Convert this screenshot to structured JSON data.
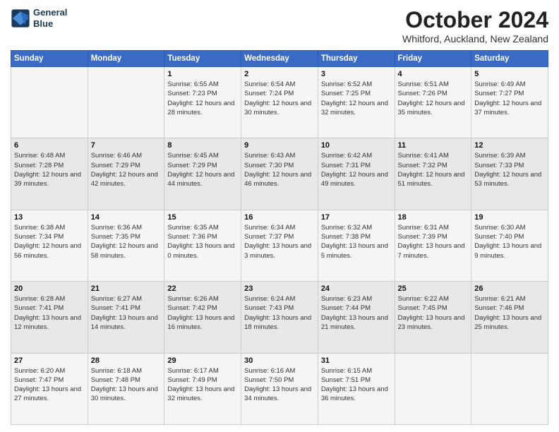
{
  "logo": {
    "line1": "General",
    "line2": "Blue"
  },
  "title": "October 2024",
  "location": "Whitford, Auckland, New Zealand",
  "days_of_week": [
    "Sunday",
    "Monday",
    "Tuesday",
    "Wednesday",
    "Thursday",
    "Friday",
    "Saturday"
  ],
  "weeks": [
    [
      {
        "day": "",
        "detail": ""
      },
      {
        "day": "",
        "detail": ""
      },
      {
        "day": "1",
        "detail": "Sunrise: 6:55 AM\nSunset: 7:23 PM\nDaylight: 12 hours\nand 28 minutes."
      },
      {
        "day": "2",
        "detail": "Sunrise: 6:54 AM\nSunset: 7:24 PM\nDaylight: 12 hours\nand 30 minutes."
      },
      {
        "day": "3",
        "detail": "Sunrise: 6:52 AM\nSunset: 7:25 PM\nDaylight: 12 hours\nand 32 minutes."
      },
      {
        "day": "4",
        "detail": "Sunrise: 6:51 AM\nSunset: 7:26 PM\nDaylight: 12 hours\nand 35 minutes."
      },
      {
        "day": "5",
        "detail": "Sunrise: 6:49 AM\nSunset: 7:27 PM\nDaylight: 12 hours\nand 37 minutes."
      }
    ],
    [
      {
        "day": "6",
        "detail": "Sunrise: 6:48 AM\nSunset: 7:28 PM\nDaylight: 12 hours\nand 39 minutes."
      },
      {
        "day": "7",
        "detail": "Sunrise: 6:46 AM\nSunset: 7:29 PM\nDaylight: 12 hours\nand 42 minutes."
      },
      {
        "day": "8",
        "detail": "Sunrise: 6:45 AM\nSunset: 7:29 PM\nDaylight: 12 hours\nand 44 minutes."
      },
      {
        "day": "9",
        "detail": "Sunrise: 6:43 AM\nSunset: 7:30 PM\nDaylight: 12 hours\nand 46 minutes."
      },
      {
        "day": "10",
        "detail": "Sunrise: 6:42 AM\nSunset: 7:31 PM\nDaylight: 12 hours\nand 49 minutes."
      },
      {
        "day": "11",
        "detail": "Sunrise: 6:41 AM\nSunset: 7:32 PM\nDaylight: 12 hours\nand 51 minutes."
      },
      {
        "day": "12",
        "detail": "Sunrise: 6:39 AM\nSunset: 7:33 PM\nDaylight: 12 hours\nand 53 minutes."
      }
    ],
    [
      {
        "day": "13",
        "detail": "Sunrise: 6:38 AM\nSunset: 7:34 PM\nDaylight: 12 hours\nand 56 minutes."
      },
      {
        "day": "14",
        "detail": "Sunrise: 6:36 AM\nSunset: 7:35 PM\nDaylight: 12 hours\nand 58 minutes."
      },
      {
        "day": "15",
        "detail": "Sunrise: 6:35 AM\nSunset: 7:36 PM\nDaylight: 13 hours\nand 0 minutes."
      },
      {
        "day": "16",
        "detail": "Sunrise: 6:34 AM\nSunset: 7:37 PM\nDaylight: 13 hours\nand 3 minutes."
      },
      {
        "day": "17",
        "detail": "Sunrise: 6:32 AM\nSunset: 7:38 PM\nDaylight: 13 hours\nand 5 minutes."
      },
      {
        "day": "18",
        "detail": "Sunrise: 6:31 AM\nSunset: 7:39 PM\nDaylight: 13 hours\nand 7 minutes."
      },
      {
        "day": "19",
        "detail": "Sunrise: 6:30 AM\nSunset: 7:40 PM\nDaylight: 13 hours\nand 9 minutes."
      }
    ],
    [
      {
        "day": "20",
        "detail": "Sunrise: 6:28 AM\nSunset: 7:41 PM\nDaylight: 13 hours\nand 12 minutes."
      },
      {
        "day": "21",
        "detail": "Sunrise: 6:27 AM\nSunset: 7:41 PM\nDaylight: 13 hours\nand 14 minutes."
      },
      {
        "day": "22",
        "detail": "Sunrise: 6:26 AM\nSunset: 7:42 PM\nDaylight: 13 hours\nand 16 minutes."
      },
      {
        "day": "23",
        "detail": "Sunrise: 6:24 AM\nSunset: 7:43 PM\nDaylight: 13 hours\nand 18 minutes."
      },
      {
        "day": "24",
        "detail": "Sunrise: 6:23 AM\nSunset: 7:44 PM\nDaylight: 13 hours\nand 21 minutes."
      },
      {
        "day": "25",
        "detail": "Sunrise: 6:22 AM\nSunset: 7:45 PM\nDaylight: 13 hours\nand 23 minutes."
      },
      {
        "day": "26",
        "detail": "Sunrise: 6:21 AM\nSunset: 7:46 PM\nDaylight: 13 hours\nand 25 minutes."
      }
    ],
    [
      {
        "day": "27",
        "detail": "Sunrise: 6:20 AM\nSunset: 7:47 PM\nDaylight: 13 hours\nand 27 minutes."
      },
      {
        "day": "28",
        "detail": "Sunrise: 6:18 AM\nSunset: 7:48 PM\nDaylight: 13 hours\nand 30 minutes."
      },
      {
        "day": "29",
        "detail": "Sunrise: 6:17 AM\nSunset: 7:49 PM\nDaylight: 13 hours\nand 32 minutes."
      },
      {
        "day": "30",
        "detail": "Sunrise: 6:16 AM\nSunset: 7:50 PM\nDaylight: 13 hours\nand 34 minutes."
      },
      {
        "day": "31",
        "detail": "Sunrise: 6:15 AM\nSunset: 7:51 PM\nDaylight: 13 hours\nand 36 minutes."
      },
      {
        "day": "",
        "detail": ""
      },
      {
        "day": "",
        "detail": ""
      }
    ]
  ]
}
